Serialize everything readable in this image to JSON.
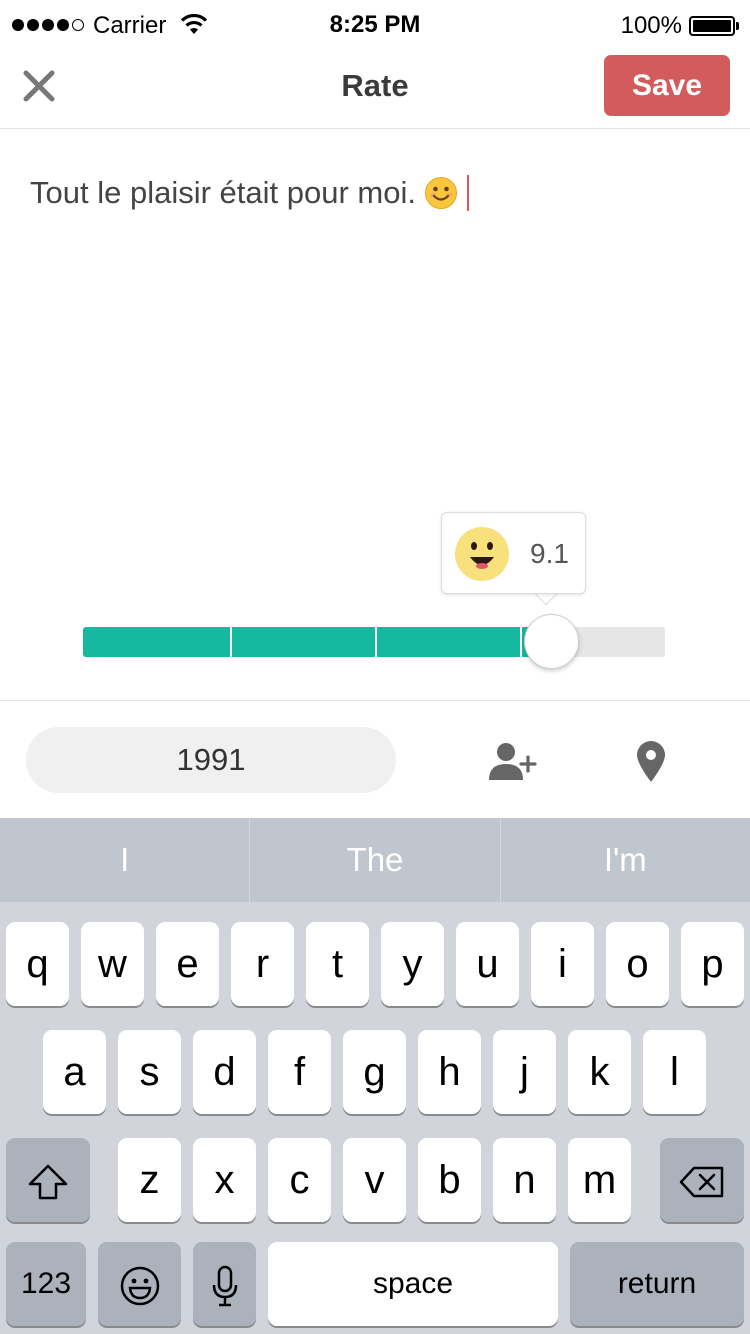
{
  "status_bar": {
    "carrier": "Carrier",
    "time": "8:25 PM",
    "battery": "100%"
  },
  "nav": {
    "title": "Rate",
    "save_label": "Save"
  },
  "review": {
    "text": "Tout le plaisir était pour moi."
  },
  "rating": {
    "value": "9.1",
    "level": 0.8
  },
  "toolbar": {
    "year": "1991"
  },
  "keyboard": {
    "suggestions": [
      "I",
      "The",
      "I'm"
    ],
    "row1": [
      "q",
      "w",
      "e",
      "r",
      "t",
      "y",
      "u",
      "i",
      "o",
      "p"
    ],
    "row2": [
      "a",
      "s",
      "d",
      "f",
      "g",
      "h",
      "j",
      "k",
      "l"
    ],
    "row3": [
      "z",
      "x",
      "c",
      "v",
      "b",
      "n",
      "m"
    ],
    "numbers_label": "123",
    "space_label": "space",
    "return_label": "return"
  },
  "colors": {
    "accent": "#d45b5b",
    "slider": "#17b8a0"
  }
}
